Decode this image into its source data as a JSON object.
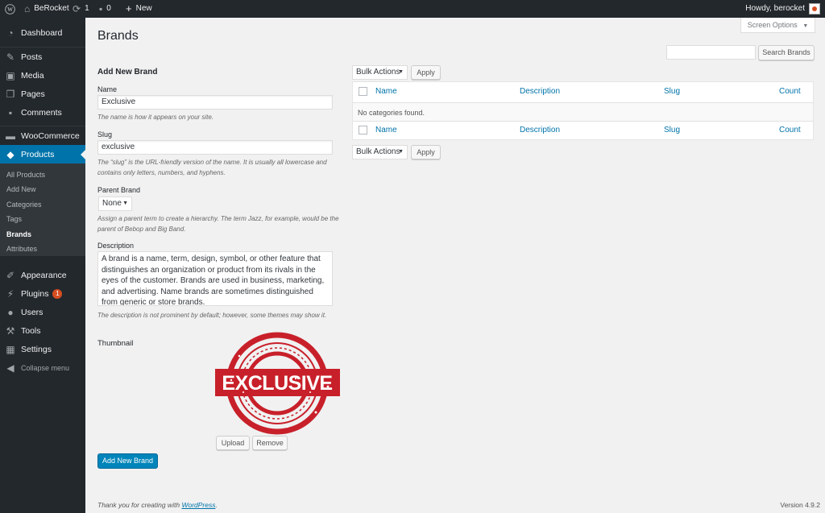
{
  "admin_bar": {
    "site_name": "BeRocket",
    "updates_count": "1",
    "comments_count": "0",
    "new_label": "New",
    "howdy": "Howdy, berocket"
  },
  "sidebar": {
    "items": [
      {
        "label": "Dashboard",
        "icon": "dashboard-icon"
      },
      {
        "label": "Posts",
        "icon": "pin-icon"
      },
      {
        "label": "Media",
        "icon": "media-icon"
      },
      {
        "label": "Pages",
        "icon": "pages-icon"
      },
      {
        "label": "Comments",
        "icon": "comment-icon"
      },
      {
        "label": "WooCommerce",
        "icon": "woo-icon"
      },
      {
        "label": "Products",
        "icon": "box-icon"
      },
      {
        "label": "Appearance",
        "icon": "brush-icon"
      },
      {
        "label": "Plugins",
        "icon": "plug-icon",
        "badge": "1"
      },
      {
        "label": "Users",
        "icon": "user-icon"
      },
      {
        "label": "Tools",
        "icon": "wrench-icon"
      },
      {
        "label": "Settings",
        "icon": "settings-icon"
      },
      {
        "label": "Collapse menu",
        "icon": "collapse-icon"
      }
    ],
    "submenu": [
      "All Products",
      "Add New",
      "Categories",
      "Tags",
      "Brands",
      "Attributes"
    ]
  },
  "page": {
    "title": "Brands",
    "screen_options": "Screen Options",
    "search_button": "Search Brands"
  },
  "form": {
    "title": "Add New Brand",
    "name_label": "Name",
    "name_value": "Exclusive",
    "name_hint": "The name is how it appears on your site.",
    "slug_label": "Slug",
    "slug_value": "exclusive",
    "slug_hint": "The “slug” is the URL-friendly version of the name. It is usually all lowercase and contains only letters, numbers, and hyphens.",
    "parent_label": "Parent Brand",
    "parent_value": "None",
    "parent_hint": "Assign a parent term to create a hierarchy. The term Jazz, for example, would be the parent of Bebop and Big Band.",
    "description_label": "Description",
    "description_value": "A brand is a name, term, design, symbol, or other feature that distinguishes an organization or product from its rivals in the eyes of the customer. Brands are used in business, marketing, and advertising. Name brands are sometimes distinguished from generic or store brands.",
    "description_hint": "The description is not prominent by default; however, some themes may show it.",
    "thumbnail_label": "Thumbnail",
    "stamp_text": "EXCLUSIVE",
    "upload_button": "Upload",
    "remove_button": "Remove",
    "submit_button": "Add New Brand"
  },
  "table": {
    "bulk_actions": "Bulk Actions",
    "apply": "Apply",
    "columns": [
      "Name",
      "Description",
      "Slug",
      "Count"
    ],
    "empty_message": "No categories found."
  },
  "footer": {
    "thanks_prefix": "Thank you for creating with",
    "thanks_link": "WordPress",
    "thanks_suffix": ".",
    "version": "Version 4.9.2"
  },
  "colors": {
    "accent": "#0073aa",
    "primary_button": "#0085ba",
    "admin_dark": "#23282d",
    "stamp_red": "#c8202a",
    "badge": "#d54e21"
  }
}
